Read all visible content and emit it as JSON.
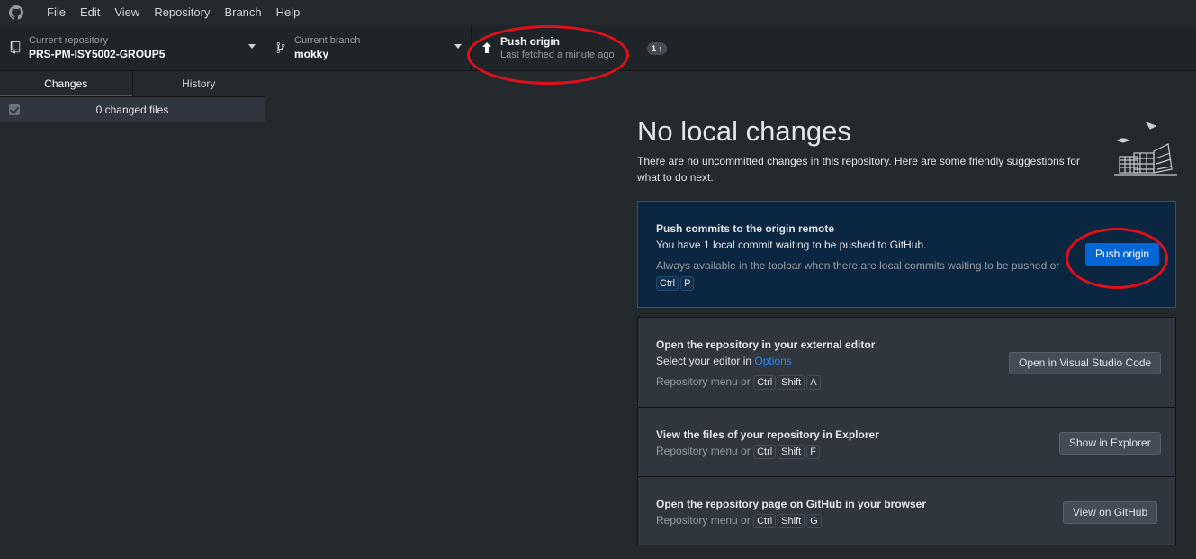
{
  "menu": [
    "File",
    "Edit",
    "View",
    "Repository",
    "Branch",
    "Help"
  ],
  "toolbar": {
    "repo": {
      "desc": "Current repository",
      "title": "PRS-PM-ISY5002-GROUP5"
    },
    "branch": {
      "desc": "Current branch",
      "title": "mokky"
    },
    "push": {
      "title": "Push origin",
      "desc": "Last fetched a minute ago",
      "badge": "1 ↑"
    }
  },
  "sidebar": {
    "tabs": [
      "Changes",
      "History"
    ],
    "changed_files": "0 changed files"
  },
  "main": {
    "heading": "No local changes",
    "subtext": "There are no uncommitted changes in this repository. Here are some friendly suggestions for what to do next.",
    "push_card": {
      "title": "Push commits to the origin remote",
      "desc": "You have 1 local commit waiting to be pushed to GitHub.",
      "hint": "Always available in the toolbar when there are local commits waiting to be pushed or",
      "keys": [
        "Ctrl",
        "P"
      ],
      "button": "Push origin"
    },
    "editor_card": {
      "title": "Open the repository in your external editor",
      "desc_prefix": "Select your editor in ",
      "desc_link": "Options",
      "hint": "Repository menu or",
      "keys": [
        "Ctrl",
        "Shift",
        "A"
      ],
      "button": "Open in Visual Studio Code"
    },
    "explorer_card": {
      "title": "View the files of your repository in Explorer",
      "hint": "Repository menu or",
      "keys": [
        "Ctrl",
        "Shift",
        "F"
      ],
      "button": "Show in Explorer"
    },
    "github_card": {
      "title": "Open the repository page on GitHub in your browser",
      "hint": "Repository menu or",
      "keys": [
        "Ctrl",
        "Shift",
        "G"
      ],
      "button": "View on GitHub"
    }
  },
  "colors": {
    "accent": "#0366d6",
    "annotation": "#e0101a",
    "background": "#24292e"
  }
}
